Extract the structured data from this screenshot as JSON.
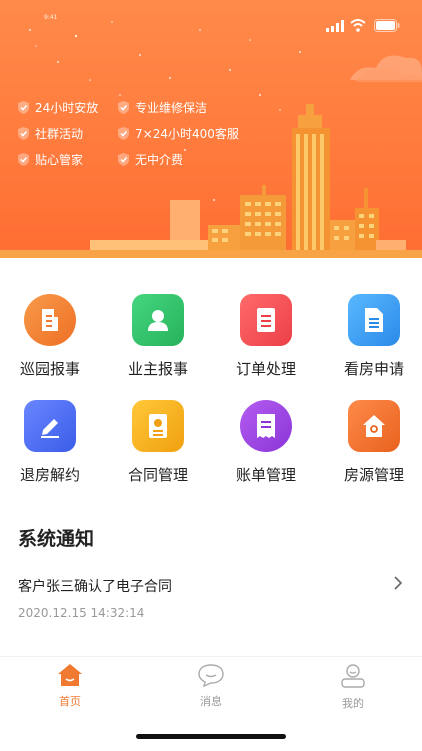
{
  "status": {
    "time": "9:41"
  },
  "hero": {
    "features": [
      "24小时安放",
      "专业维修保洁",
      "社群活动",
      "7×24小时400客服",
      "贴心管家",
      "无中介费"
    ]
  },
  "menu": [
    {
      "label": "巡园报事",
      "icon": "document-icon",
      "color": "#f07a32"
    },
    {
      "label": "业主报事",
      "icon": "person-icon",
      "color": "#33c06a"
    },
    {
      "label": "订单处理",
      "icon": "list-icon",
      "color": "#f0505a"
    },
    {
      "label": "看房申请",
      "icon": "file-icon",
      "color": "#3c9ef0"
    },
    {
      "label": "退房解约",
      "icon": "edit-icon",
      "color": "#4a6cf0"
    },
    {
      "label": "合同管理",
      "icon": "contract-icon",
      "color": "#f5b020"
    },
    {
      "label": "账单管理",
      "icon": "receipt-icon",
      "color": "#9b45e0"
    },
    {
      "label": "房源管理",
      "icon": "house-icon",
      "color": "#f07032"
    }
  ],
  "notices": {
    "title": "系统通知",
    "items": [
      {
        "text": "客户张三确认了电子合同",
        "time": "2020.12.15 14:32:14"
      }
    ]
  },
  "tabbar": {
    "items": [
      {
        "label": "首页",
        "icon": "home-icon",
        "active": true
      },
      {
        "label": "消息",
        "icon": "chat-icon",
        "active": false
      },
      {
        "label": "我的",
        "icon": "profile-icon",
        "active": false
      }
    ],
    "active_color": "#f07a32",
    "inactive_color": "#999999"
  }
}
